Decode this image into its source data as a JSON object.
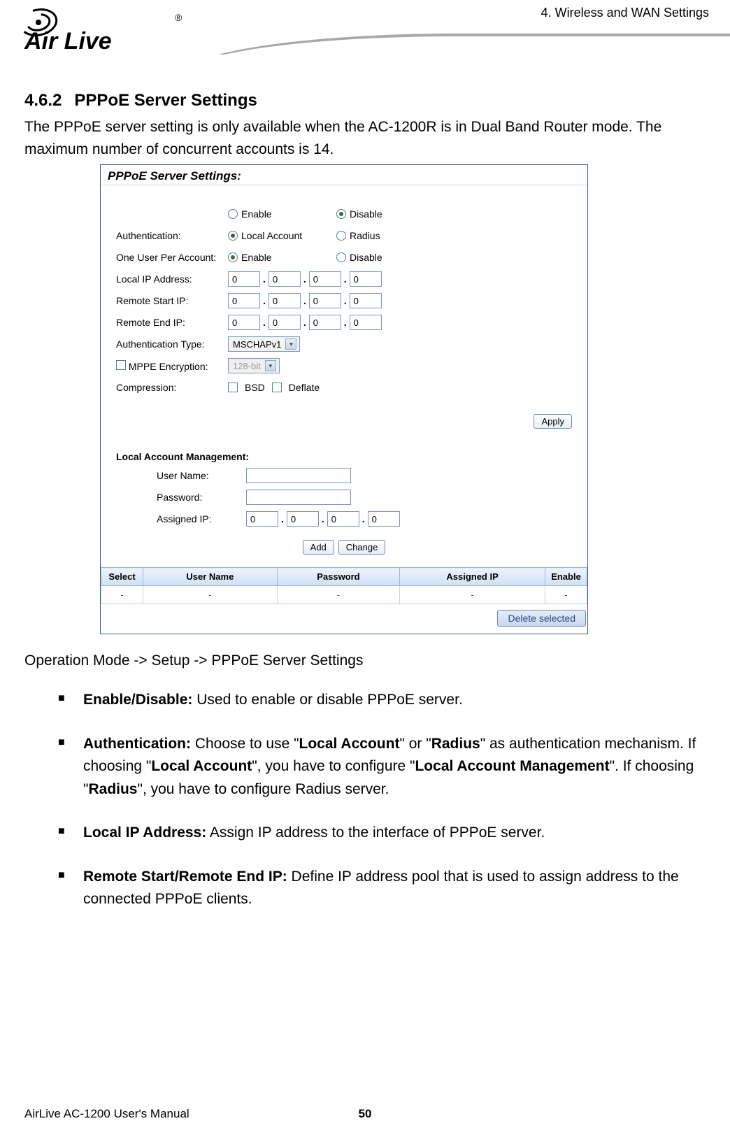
{
  "header": {
    "chapter": "4. Wireless and WAN Settings",
    "logo_text": "Air Live",
    "logo_reg": "®"
  },
  "section": {
    "num": "4.6.2",
    "title": "PPPoE Server Settings",
    "intro": "The PPPoE server setting is only available when the AC-1200R is in Dual Band Router mode.   The maximum number of concurrent accounts is 14."
  },
  "shot": {
    "title": "PPPoE Server Settings:",
    "enable": "Enable",
    "disable": "Disable",
    "auth_label": "Authentication:",
    "auth_local": "Local Account",
    "auth_radius": "Radius",
    "oupa_label": "One User Per Account:",
    "oupa_enable": "Enable",
    "oupa_disable": "Disable",
    "local_ip_label": "Local IP Address:",
    "rstart_label": "Remote Start IP:",
    "rend_label": "Remote End IP:",
    "ip": [
      "0",
      "0",
      "0",
      "0"
    ],
    "authtype_label": "Authentication Type:",
    "authtype_val": "MSCHAPv1",
    "mppe_label": "MPPE Encryption:",
    "mppe_val": "128-bit",
    "comp_label": "Compression:",
    "comp_bsd": "BSD",
    "comp_deflate": "Deflate",
    "apply": "Apply",
    "lam_title": "Local Account Management:",
    "uname_label": "User Name:",
    "pwd_label": "Password:",
    "aip_label": "Assigned IP:",
    "add": "Add",
    "change": "Change",
    "th_select": "Select",
    "th_uname": "User Name",
    "th_pwd": "Password",
    "th_aip": "Assigned IP",
    "th_enable": "Enable",
    "dash": "-",
    "delete": "Delete selected"
  },
  "breadcrumb": "Operation Mode -> Setup -> PPPoE Server Settings",
  "bullets": {
    "b1_t": "Enable/Disable:",
    "b1": " Used to enable or disable PPPoE server.",
    "b2_t": "Authentication:",
    "b2a": " Choose to use \"",
    "b2la": "Local Account",
    "b2b": "\" or \"",
    "b2rad": "Radius",
    "b2c": "\" as authentication mechanism. If choosing \"",
    "b2d": "\", you have to configure \"",
    "b2lam": "Local Account Management",
    "b2e": "\". If choosing \"",
    "b2f": "\", you have to configure Radius server.",
    "b3_t": "Local IP Address:",
    "b3": " Assign IP address to the interface of PPPoE server.",
    "b4_t": "Remote Start/Remote End IP:",
    "b4": " Define IP address pool that is used to assign address to the connected PPPoE clients."
  },
  "footer": {
    "manual": "AirLive AC-1200 User's Manual",
    "page": "50"
  }
}
